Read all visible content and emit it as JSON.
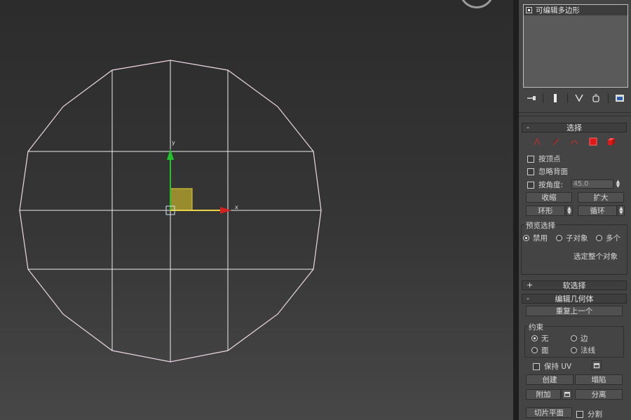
{
  "modifier_stack": {
    "items": [
      {
        "label": "可编辑多边形"
      }
    ]
  },
  "toolbar_icons": [
    "pin-stack-icon",
    "show-end-result-icon",
    "make-unique-icon",
    "remove-modifier-icon",
    "configure-modifier-sets-icon"
  ],
  "selection_rollout": {
    "sign": "-",
    "title": "选择",
    "level_icons": [
      "vertex-icon",
      "edge-icon",
      "border-icon",
      "polygon-icon",
      "element-icon"
    ],
    "checkbox_by_vertex": "按顶点",
    "checkbox_ignore_backfacing": "忽略背面",
    "checkbox_by_angle": "按角度:",
    "angle_value": "45.0",
    "shrink": "收缩",
    "grow": "扩大",
    "ring": "环形",
    "loop": "循环",
    "preview_label": "预览选择",
    "preview_options": [
      "禁用",
      "子对象",
      "多个"
    ],
    "status": "选定整个对象"
  },
  "soft_selection": {
    "sign": "+",
    "title": "软选择"
  },
  "edit_geometry": {
    "sign": "-",
    "title": "编辑几何体",
    "repeat_last": "重复上一个",
    "constraints_label": "约束",
    "constraints": [
      "无",
      "边",
      "面",
      "法线"
    ],
    "preserve_uv": "保持 UV",
    "create": "创建",
    "collapse": "塌陷",
    "attach": "附加",
    "detach": "分离",
    "slice_plane": "切片平面",
    "split": "分割"
  },
  "viewport": {
    "axis_x": "x",
    "axis_y": "y",
    "wire_color": "#efd6e4",
    "axis_x_color": "#d42020",
    "axis_y_color": "#22c22a",
    "plane_color": "#b9a92e"
  }
}
